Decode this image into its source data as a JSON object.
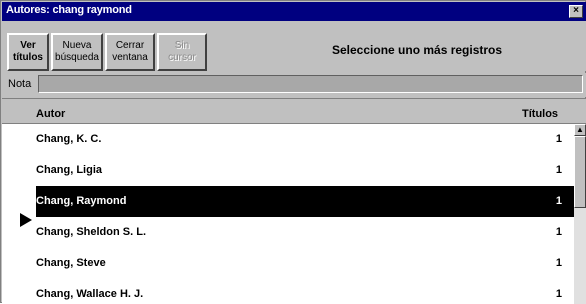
{
  "window": {
    "title": "Autores: chang raymond",
    "close_glyph": "×"
  },
  "toolbar": {
    "buttons": [
      {
        "line1": "Ver",
        "line2": "títulos",
        "enabled": true,
        "bold": true
      },
      {
        "line1": "Nueva",
        "line2": "búsqueda",
        "enabled": true,
        "bold": false
      },
      {
        "line1": "Cerrar",
        "line2": "ventana",
        "enabled": true,
        "bold": false
      },
      {
        "line1": "Sin",
        "line2": "cursor",
        "enabled": false,
        "bold": false
      }
    ],
    "hint": "Seleccione uno más registros"
  },
  "note": {
    "label": "Nota",
    "value": ""
  },
  "table": {
    "columns": [
      "Autor",
      "Títulos"
    ],
    "rows": [
      {
        "autor": "Chang, K. C.",
        "titulos": "1",
        "selected": false
      },
      {
        "autor": "Chang, Ligia",
        "titulos": "1",
        "selected": false
      },
      {
        "autor": "Chang, Raymond",
        "titulos": "1",
        "selected": true
      },
      {
        "autor": "Chang, Sheldon S. L.",
        "titulos": "1",
        "selected": false
      },
      {
        "autor": "Chang, Steve",
        "titulos": "1",
        "selected": false
      },
      {
        "autor": "Chang, Wallace H. J.",
        "titulos": "1",
        "selected": false
      }
    ]
  },
  "icons": {
    "row_pointer": "arrow-right-icon",
    "scroll_up": "chevron-up-icon",
    "close": "close-icon"
  },
  "colors": {
    "titlebar": "#000080",
    "selection": "#000000",
    "face": "#c0c0c0"
  }
}
